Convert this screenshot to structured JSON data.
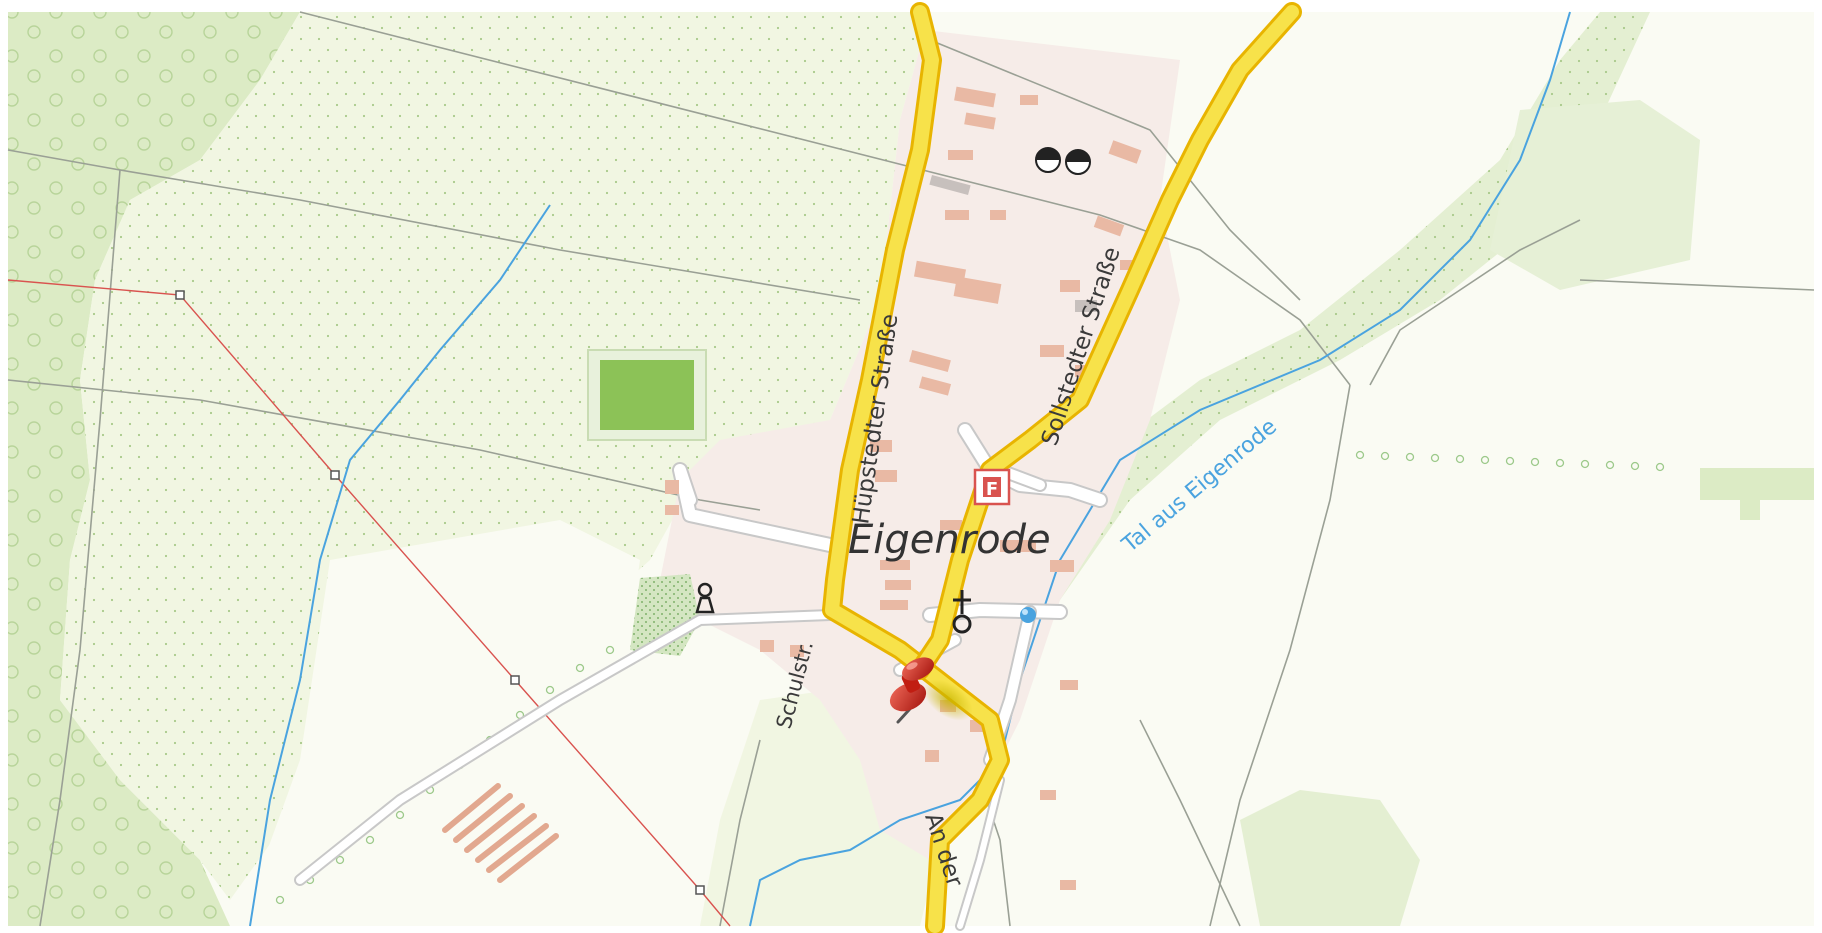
{
  "map": {
    "place_label": "Eigenrode",
    "streets": {
      "huepstedter": "Hüpstedter Straße",
      "sollstedter": "Sollstedter Straße",
      "schulstr": "Schulstr.",
      "an_der": "An der"
    },
    "water_label": "Tal aus Eigenrode",
    "fire_station_letter": "F"
  },
  "colors": {
    "forest": "#dfecc8",
    "forest_dark": "#cfe3b3",
    "meadow": "#f2f6e4",
    "settlement": "#f7ede8",
    "building": "#e9b9a4",
    "road_fill": "#f7e24a",
    "road_casing": "#e8b400",
    "stream": "#4aa3df",
    "power_line": "#d9534f",
    "pin": "#d42a1e",
    "field_green": "#8cc257"
  }
}
